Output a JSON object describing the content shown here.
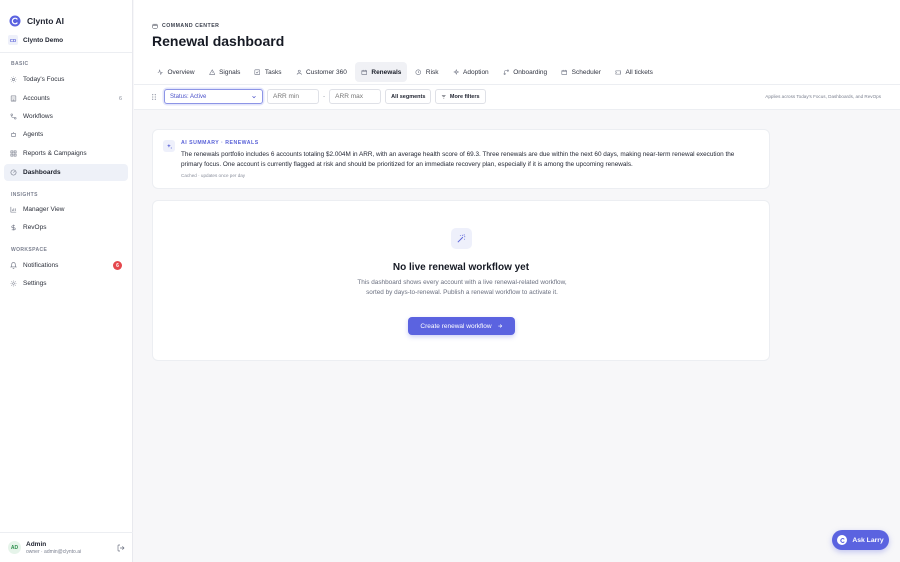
{
  "brand": {
    "name": "Clynto AI"
  },
  "org": {
    "initials": "CD",
    "name": "Clynto Demo"
  },
  "sidebar": {
    "sections": [
      {
        "label": "BASIC"
      },
      {
        "label": "INSIGHTS"
      },
      {
        "label": "WORKSPACE"
      }
    ],
    "items": [
      {
        "label": "Today's Focus",
        "icon": "sun-icon"
      },
      {
        "label": "Accounts",
        "icon": "building-icon",
        "count": "6"
      },
      {
        "label": "Workflows",
        "icon": "workflow-icon"
      },
      {
        "label": "Agents",
        "icon": "bot-icon"
      },
      {
        "label": "Reports & Campaigns",
        "icon": "grid-icon"
      },
      {
        "label": "Dashboards",
        "icon": "dashboard-icon",
        "active": true
      },
      {
        "label": "Manager View",
        "icon": "bar-chart-icon"
      },
      {
        "label": "RevOps",
        "icon": "dollar-icon"
      },
      {
        "label": "Notifications",
        "icon": "bell-icon",
        "badge": "6"
      },
      {
        "label": "Settings",
        "icon": "gear-icon"
      }
    ]
  },
  "user": {
    "initials": "AD",
    "name": "Admin",
    "subtitle": "owner · admin@clynto.ai"
  },
  "header": {
    "eyebrow": "COMMAND CENTER",
    "title": "Renewal dashboard",
    "tabs": [
      {
        "label": "Overview",
        "icon": "activity-icon"
      },
      {
        "label": "Signals",
        "icon": "alert-icon"
      },
      {
        "label": "Tasks",
        "icon": "checkbox-icon"
      },
      {
        "label": "Customer 360",
        "icon": "user-icon"
      },
      {
        "label": "Renewals",
        "icon": "calendar-icon",
        "active": true
      },
      {
        "label": "Risk",
        "icon": "clock-icon"
      },
      {
        "label": "Adoption",
        "icon": "sparkle-icon"
      },
      {
        "label": "Onboarding",
        "icon": "git-icon"
      },
      {
        "label": "Scheduler",
        "icon": "calendar-icon"
      },
      {
        "label": "All tickets",
        "icon": "ticket-icon"
      }
    ]
  },
  "filters": {
    "status_value": "Status: Active",
    "arr_min_placeholder": "ARR min",
    "dash": "-",
    "arr_max_placeholder": "ARR max",
    "segments_label": "All segments",
    "more_filters_label": "More filters",
    "applies_note": "Applies across Today's Focus, Dashboards, and RevOps"
  },
  "summary": {
    "label": "AI SUMMARY · RENEWALS",
    "text": "The renewals portfolio includes 6 accounts totaling $2.004M in ARR, with an average health score of 69.3. Three renewals are due within the next 60 days, making near-term renewal execution the primary focus. One account is currently flagged at risk and should be prioritized for an immediate recovery plan, especially if it is among the upcoming renewals.",
    "meta": "Cached · updates once per day"
  },
  "empty_state": {
    "title": "No live renewal workflow yet",
    "description": "This dashboard shows every account with a live renewal-related workflow, sorted by days-to-renewal. Publish a renewal workflow to activate it.",
    "cta_label": "Create renewal workflow"
  },
  "assistant": {
    "label": "Ask Larry"
  },
  "colors": {
    "accent": "#5b63e0",
    "badge_red": "#e5484d"
  }
}
